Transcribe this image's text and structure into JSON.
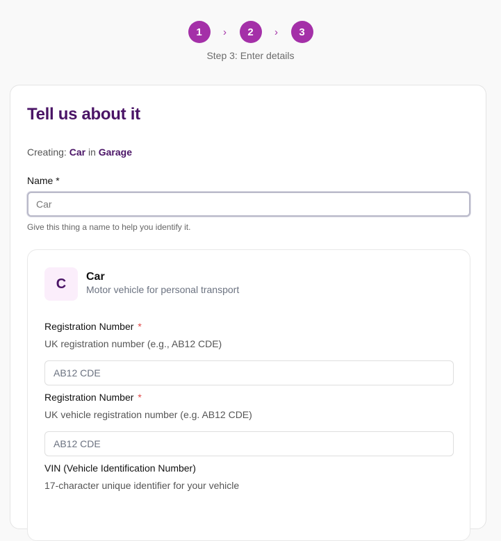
{
  "stepper": {
    "steps": [
      "1",
      "2",
      "3"
    ],
    "separator": "›",
    "caption": "Step 3: Enter details"
  },
  "card": {
    "title": "Tell us about it",
    "creating_prefix": "Creating:",
    "creating_type": "Car",
    "creating_in": "in",
    "creating_location": "Garage"
  },
  "name_field": {
    "label": "Name *",
    "placeholder": "Car",
    "value": "",
    "help": "Give this thing a name to help you identify it."
  },
  "type_card": {
    "avatar_letter": "C",
    "name": "Car",
    "description": "Motor vehicle for personal transport"
  },
  "attributes": [
    {
      "label": "Registration Number",
      "required_mark": "*",
      "description": "UK registration number (e.g., AB12 CDE)",
      "placeholder": "AB12 CDE"
    },
    {
      "label": "Registration Number",
      "required_mark": "*",
      "description": "UK vehicle registration number (e.g. AB12 CDE)",
      "placeholder": "AB12 CDE"
    },
    {
      "label": "VIN (Vehicle Identification Number)",
      "description": "17-character unique identifier for your vehicle"
    }
  ],
  "colors": {
    "accent": "#a430a8",
    "heading": "#4a1466",
    "required": "#e04646"
  }
}
